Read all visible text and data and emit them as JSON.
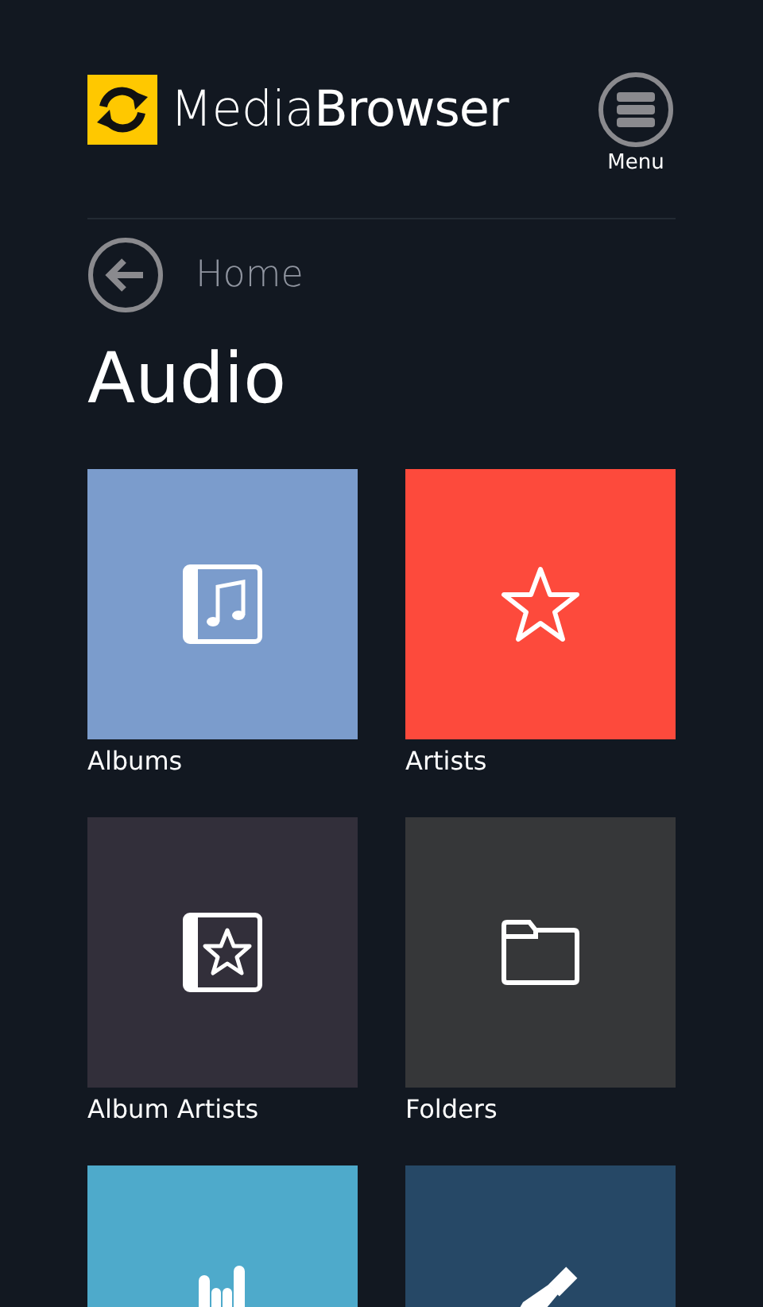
{
  "header": {
    "logo_text_light": "Media",
    "logo_text_bold": "Browser",
    "menu_label": "Menu"
  },
  "breadcrumb": {
    "label": "Home"
  },
  "title": "Audio",
  "tiles": [
    {
      "label": "Albums",
      "kind": "album",
      "color": "#7b9ccc"
    },
    {
      "label": "Artists",
      "kind": "star",
      "color": "#fd4a3c"
    },
    {
      "label": "Album Artists",
      "kind": "album-star",
      "color": "#322f3a"
    },
    {
      "label": "Folders",
      "kind": "folder",
      "color": "#363739"
    },
    {
      "kind": "hand",
      "color": "#4eaacb"
    },
    {
      "kind": "pen",
      "color": "#264866"
    }
  ]
}
